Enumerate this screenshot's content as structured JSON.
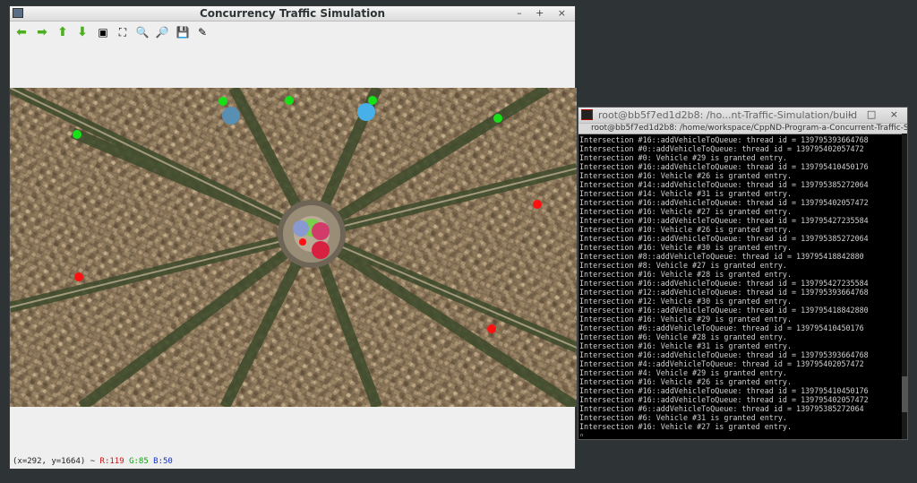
{
  "sim_window": {
    "title": "Concurrency Traffic Simulation",
    "controls": [
      "–",
      "+",
      "×"
    ],
    "toolbar": [
      {
        "icon": "arrow-left-icon",
        "glyph": "⬅"
      },
      {
        "icon": "arrow-right-icon",
        "glyph": "➡"
      },
      {
        "icon": "arrow-up-icon",
        "glyph": "⬆"
      },
      {
        "icon": "arrow-down-icon",
        "glyph": "⬇"
      },
      {
        "icon": "image-icon",
        "glyph": "▣"
      },
      {
        "icon": "crop-icon",
        "glyph": "⛶"
      },
      {
        "icon": "zoom-in-icon",
        "glyph": "🔍"
      },
      {
        "icon": "zoom-out-icon",
        "glyph": "🔎"
      },
      {
        "icon": "save-icon",
        "glyph": "💾"
      },
      {
        "icon": "properties-icon",
        "glyph": "✎"
      }
    ],
    "status": {
      "coords": "(x=292, y=1664) ~",
      "r": "R:119",
      "g": "G:85",
      "b": "B:50"
    },
    "colors": {
      "green": "#18e018",
      "red": "#ff1010",
      "vehicle_blue": "#5aa0d0"
    }
  },
  "terminal": {
    "title": "root@bb5f7ed1d2b8: /ho...nt-Traffic-Simulation/build",
    "tab_label": "root@bb5f7ed1d2b8: /home/workspace/CppND-Program-a-Concurrent-Traffic-Sim",
    "controls": [
      "–",
      "□",
      "×"
    ],
    "lines": [
      "Intersection #16::addVehicleToQueue: thread id = 139795393664768",
      "Intersection #0::addVehicleToQueue: thread id = 139795402057472",
      "Intersection #0: Vehicle #29 is granted entry.",
      "Intersection #16::addVehicleToQueue: thread id = 139795410450176",
      "Intersection #16: Vehicle #26 is granted entry.",
      "Intersection #14::addVehicleToQueue: thread id = 139795385272064",
      "Intersection #14: Vehicle #31 is granted entry.",
      "Intersection #16::addVehicleToQueue: thread id = 139795402057472",
      "Intersection #16: Vehicle #27 is granted entry.",
      "Intersection #10::addVehicleToQueue: thread id = 139795427235584",
      "Intersection #10: Vehicle #26 is granted entry.",
      "Intersection #16::addVehicleToQueue: thread id = 139795385272064",
      "Intersection #16: Vehicle #30 is granted entry.",
      "Intersection #8::addVehicleToQueue: thread id = 139795418842880",
      "Intersection #8: Vehicle #27 is granted entry.",
      "Intersection #16: Vehicle #28 is granted entry.",
      "Intersection #16::addVehicleToQueue: thread id = 139795427235584",
      "Intersection #12::addVehicleToQueue: thread id = 139795393664768",
      "Intersection #12: Vehicle #30 is granted entry.",
      "Intersection #16::addVehicleToQueue: thread id = 139795418842880",
      "Intersection #16: Vehicle #29 is granted entry.",
      "Intersection #6::addVehicleToQueue: thread id = 139795410450176",
      "Intersection #6: Vehicle #28 is granted entry.",
      "Intersection #16: Vehicle #31 is granted entry.",
      "Intersection #16::addVehicleToQueue: thread id = 139795393664768",
      "Intersection #4::addVehicleToQueue: thread id = 139795402057472",
      "Intersection #4: Vehicle #29 is granted entry.",
      "Intersection #16: Vehicle #26 is granted entry.",
      "Intersection #16::addVehicleToQueue: thread id = 139795410450176",
      "Intersection #16::addVehicleToQueue: thread id = 139795402057472",
      "Intersection #6::addVehicleToQueue: thread id = 139795385272064",
      "Intersection #6: Vehicle #31 is granted entry.",
      "Intersection #16: Vehicle #27 is granted entry.",
      "▯"
    ]
  }
}
